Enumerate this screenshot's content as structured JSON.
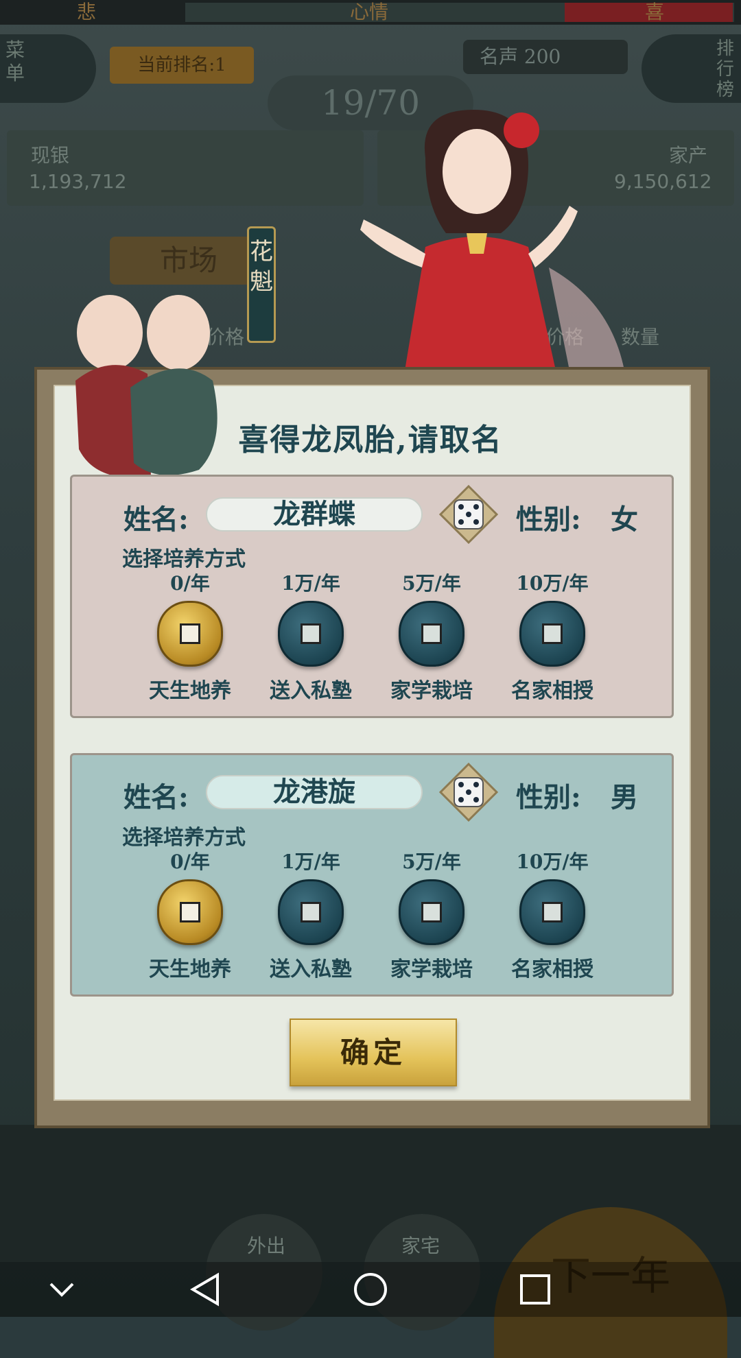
{
  "hud": {
    "mood_left": "悲",
    "mood_center": "心情",
    "mood_right": "喜",
    "menu_label": "菜单",
    "current_rank": "当前排名:1",
    "progress": "19/70",
    "fame": "名声 200",
    "leaderboard_label": "排行榜",
    "silver_label": "现银",
    "silver_value": "1,193,712",
    "assets_label": "家产",
    "assets_value": "9,150,612",
    "market_tab": "市场",
    "price_label": "价格",
    "price_label_2": "价格",
    "quantity_label": "数量",
    "outing": "外出",
    "home": "家宅",
    "next_year": "下一年"
  },
  "character": {
    "title": "花魁"
  },
  "dialog": {
    "title": "喜得龙凤胎,请取名",
    "name_label": "姓名:",
    "gender_label": "性别:",
    "method_title": "选择培养方式",
    "confirm": "确定",
    "children": [
      {
        "name": "龙群蝶",
        "gender": "女",
        "selected_option": 0
      },
      {
        "name": "龙港旋",
        "gender": "男",
        "selected_option": 0
      }
    ],
    "options": [
      {
        "cost": "0/年",
        "name": "天生地养"
      },
      {
        "cost": "1万/年",
        "name": "送入私塾"
      },
      {
        "cost": "5万/年",
        "name": "家学栽培"
      },
      {
        "cost": "10万/年",
        "name": "名家相授"
      }
    ]
  },
  "colors": {
    "accent_text": "#1f4650",
    "female_card": "#d9cbc6",
    "male_card": "#a6c4c2",
    "gold_button": "#e4c35a"
  },
  "icons": [
    "dice-icon",
    "coin-icon",
    "back-icon",
    "home-icon",
    "recents-icon",
    "collapse-icon"
  ]
}
